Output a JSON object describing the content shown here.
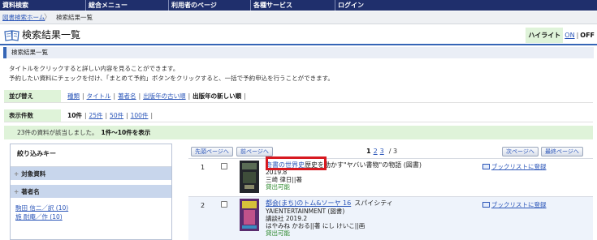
{
  "nav": [
    "資料検索",
    "総合メニュー",
    "利用者のページ",
    "各種サービス",
    "ログイン"
  ],
  "breadcrumb": {
    "home": "図書検索ホーム",
    "sep": "〉",
    "current": "検索結果一覧"
  },
  "title": "検索結果一覧",
  "highlight": {
    "label": "ハイライト",
    "on": "ON",
    "sep": "|",
    "off": "OFF"
  },
  "subheading": "検索結果一覧",
  "intro": [
    "タイトルをクリックすると詳しい内容を見ることができます。",
    "予約したい資料にチェックを付け、「まとめて予約」ボタンをクリックすると、一括で予約申込を行うことができます。"
  ],
  "sort": {
    "label": "並び替え",
    "options": [
      "種類",
      "タイトル",
      "著者名",
      "出版年の古い順"
    ],
    "current": "出版年の新しい順"
  },
  "display": {
    "label": "表示件数",
    "current": "10件",
    "options": [
      "25件",
      "50件",
      "100件"
    ]
  },
  "count": {
    "text": "23件の資料が該当しました。",
    "range": "1件〜10件を表示"
  },
  "sidebar": {
    "key_label": "絞り込みキー",
    "marker": "+",
    "section1": "対象資料",
    "section2": "著者名",
    "items": [
      "駒田 信二／訳 (10)",
      "施 耐庵／作 (10)"
    ]
  },
  "buttons": {
    "first": "先頭ページへ",
    "prev": "前ページへ",
    "next": "次ページへ",
    "last": "最終ページへ"
  },
  "pager": {
    "current": "1",
    "p2": "2",
    "p3": "3",
    "total": "/ 3"
  },
  "records": [
    {
      "num": "1",
      "title_link": "奇書の世界史",
      "title_rest": "歴史を動かす\"ヤバい書物\"の物語 (図書)",
      "line2": "2019.8",
      "line3": "三崎 律日||著",
      "status": "貸出可能",
      "bookshelf": "ブックリストに登録"
    },
    {
      "num": "2",
      "title_link": "都会(まち)のトム&ソーヤ 16",
      "title_rest": "スパイシティ",
      "line2": "YAIENTERTAINMENT (図書)",
      "line3": "講談社 2019.2",
      "line4": "はやみね かおる||著 にし けいこ||画",
      "status": "貸出可能",
      "bookshelf": "ブックリストに登録"
    }
  ],
  "colors": {
    "nav_bg": "#1f2f6c",
    "accent": "#3565b6",
    "highlight_box": "#d71920",
    "green_bg": "#dff3d9",
    "link": "#2a55b8"
  }
}
